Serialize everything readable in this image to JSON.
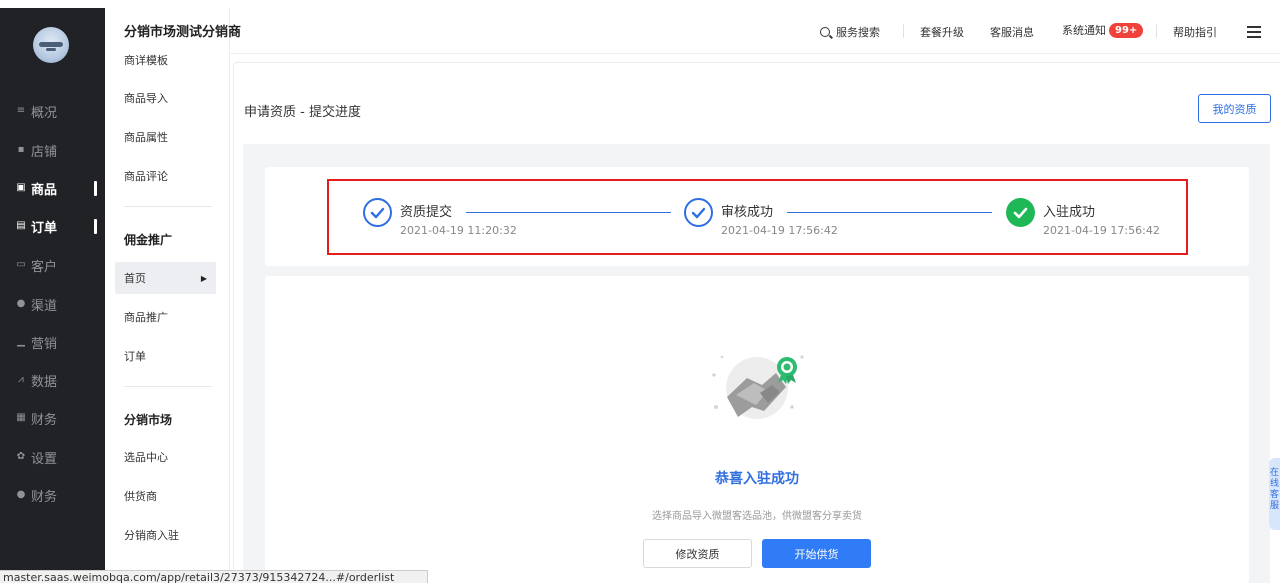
{
  "header": {
    "title": "分销市场测试分销商",
    "search": "服务搜索",
    "upgrade": "套餐升级",
    "service_msg": "客服消息",
    "system_notice": "系统通知",
    "notice_badge": "99+",
    "help": "帮助指引"
  },
  "sidebar": {
    "items": [
      {
        "label": "概况",
        "icon": "overview-icon"
      },
      {
        "label": "店铺",
        "icon": "shop-icon"
      },
      {
        "label": "商品",
        "icon": "goods-icon"
      },
      {
        "label": "订单",
        "icon": "order-icon"
      },
      {
        "label": "客户",
        "icon": "customer-icon"
      },
      {
        "label": "渠道",
        "icon": "channel-icon"
      },
      {
        "label": "营销",
        "icon": "marketing-icon"
      },
      {
        "label": "数据",
        "icon": "data-icon"
      },
      {
        "label": "财务",
        "icon": "finance-icon"
      },
      {
        "label": "设置",
        "icon": "settings-icon"
      },
      {
        "label": "财务",
        "icon": "finance2-icon"
      }
    ]
  },
  "subnav": {
    "cut_item": "商详模板",
    "items_top": [
      "商品导入",
      "商品属性",
      "商品评论"
    ],
    "group1": "佣金推广",
    "group1_items": [
      "首页",
      "商品推广",
      "订单"
    ],
    "group2": "分销市场",
    "group2_items": [
      "选品中心",
      "供货商",
      "分销商入驻"
    ]
  },
  "page": {
    "title": "申请资质 - 提交进度",
    "my_button": "我的资质"
  },
  "steps": [
    {
      "label": "资质提交",
      "time": "2021-04-19 11:20:32",
      "state": "done"
    },
    {
      "label": "审核成功",
      "time": "2021-04-19 17:56:42",
      "state": "done"
    },
    {
      "label": "入驻成功",
      "time": "2021-04-19 17:56:42",
      "state": "success"
    }
  ],
  "success": {
    "title": "恭喜入驻成功",
    "desc": "选择商品导入微盟客选品池，供微盟客分享卖货",
    "edit_button": "修改资质",
    "start_button": "开始供货"
  },
  "side_tab": "在线客服",
  "status_url": "master.saas.weimobqa.com/app/retail3/27373/915342724...#/orderlist",
  "colors": {
    "accent": "#2f6fe0",
    "success": "#1fb856",
    "badge": "#f0413b",
    "highlight": "#e31c1c",
    "sidebar_bg": "#202226"
  }
}
